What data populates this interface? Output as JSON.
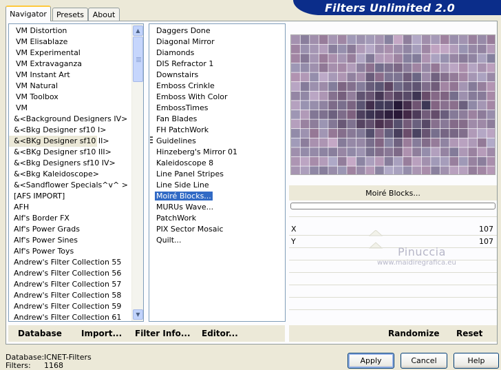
{
  "tabs": [
    "Navigator",
    "Presets",
    "About"
  ],
  "banner_title": "Filters Unlimited 2.0",
  "categories": [
    "VM Distortion",
    "VM Elisablaze",
    "VM Experimental",
    "VM Extravaganza",
    "VM Instant Art",
    "VM Natural",
    "VM Toolbox",
    "VM",
    "&<Background Designers IV>",
    "&<Bkg Designer sf10 I>",
    "&<BKg Designer sf10 II>",
    "&<BKg Designer sf10 III>",
    "&<Bkg Designers sf10 IV>",
    "&<Bkg Kaleidoscope>",
    "&<Sandflower Specials^v^ >",
    "[AFS IMPORT]",
    "AFH",
    "Alf's Border FX",
    "Alf's Power Grads",
    "Alf's Power Sines",
    "Alf's Power Toys",
    "Andrew's Filter Collection 55",
    "Andrew's Filter Collection 56",
    "Andrew's Filter Collection 57",
    "Andrew's Filter Collection 58",
    "Andrew's Filter Collection 59",
    "Andrew's Filter Collection 61"
  ],
  "categories_selected_index": 10,
  "filters": [
    "Daggers Done",
    "Diagonal Mirror",
    "Diamonds",
    "DIS Refractor 1",
    "Downstairs",
    "Emboss Crinkle",
    "Emboss With Color",
    "EmbossTimes",
    "Fan Blades",
    "FH PatchWork",
    "Guidelines",
    "Hinzeberg's Mirror 01",
    "Kaleidoscope 8",
    "Line Panel Stripes",
    "Line Side Line",
    "Moiré Blocks...",
    "MURUs Wave...",
    "PatchWork",
    "PIX Sector Mosaic",
    "Quilt..."
  ],
  "filters_selected_index": 15,
  "filter_name": "Moiré Blocks...",
  "progress": 0,
  "params": [
    {
      "label": "X",
      "value": "107"
    },
    {
      "label": "Y",
      "value": "107"
    }
  ],
  "watermark": {
    "line1": "Pinuccia",
    "line2": "www.maidiregrafica.eu"
  },
  "toolbar_left": [
    "Database",
    "Import...",
    "Filter Info...",
    "Editor..."
  ],
  "toolbar_right": [
    "Randomize",
    "Reset"
  ],
  "status": {
    "database_label": "Database:",
    "database_value": "ICNET-Filters",
    "filters_label": "Filters:",
    "filters_value": "1168"
  },
  "buttons": {
    "apply": "Apply",
    "cancel": "Cancel",
    "help": "Help"
  },
  "colors": {
    "banner": "#0b2d8a",
    "selection": "#316ac5",
    "active_tab_accent": "#ffc83c"
  }
}
